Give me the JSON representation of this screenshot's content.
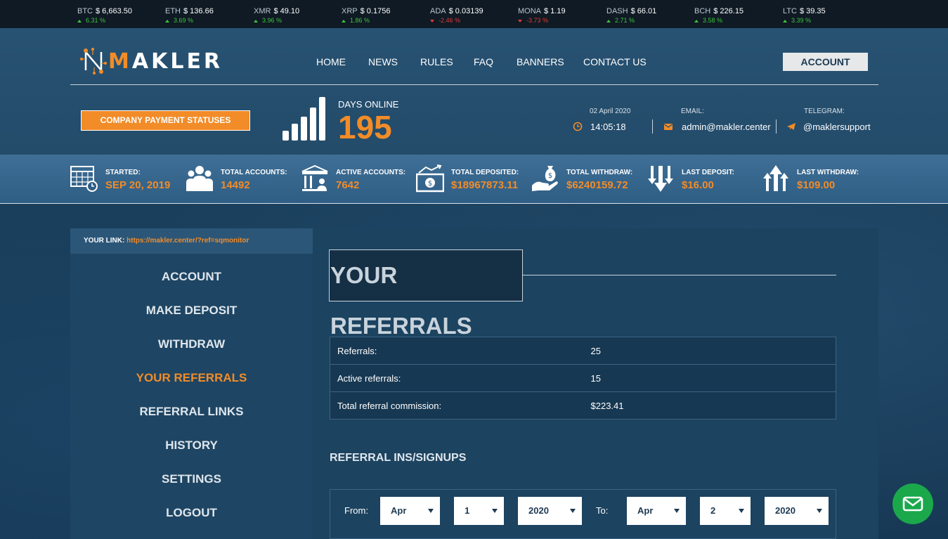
{
  "ticker": [
    {
      "sym": "BTC",
      "price": "$ 6,663.50",
      "change": "6.31 %",
      "dir": "up"
    },
    {
      "sym": "ETH",
      "price": "$ 136.66",
      "change": "3.69 %",
      "dir": "up"
    },
    {
      "sym": "XMR",
      "price": "$ 49.10",
      "change": "3.96 %",
      "dir": "up"
    },
    {
      "sym": "XRP",
      "price": "$ 0.1756",
      "change": "1.86 %",
      "dir": "up"
    },
    {
      "sym": "ADA",
      "price": "$ 0.03139",
      "change": "-2.46 %",
      "dir": "down"
    },
    {
      "sym": "MONA",
      "price": "$ 1.19",
      "change": "-3.73 %",
      "dir": "down"
    },
    {
      "sym": "DASH",
      "price": "$ 66.01",
      "change": "2.71 %",
      "dir": "up"
    },
    {
      "sym": "BCH",
      "price": "$ 226.15",
      "change": "3.58 %",
      "dir": "up"
    },
    {
      "sym": "LTC",
      "price": "$ 39.35",
      "change": "3.39 %",
      "dir": "up"
    }
  ],
  "brand": {
    "initial": "M",
    "rest": "AKLER"
  },
  "nav": [
    "HOME",
    "NEWS",
    "RULES",
    "FAQ",
    "BANNERS",
    "CONTACT US"
  ],
  "account_button": "ACCOUNT",
  "payment_statuses_button": "COMPANY PAYMENT STATUSES",
  "days_online": {
    "label": "DAYS ONLINE",
    "value": "195"
  },
  "datetime": {
    "date": "02 April 2020",
    "time": "14:05:18"
  },
  "email": {
    "label": "EMAIL:",
    "value": "admin@makler.center"
  },
  "telegram": {
    "label": "TELEGRAM:",
    "value": "@maklersupport"
  },
  "stats": [
    {
      "label": "STARTED:",
      "value": "SEP 20, 2019",
      "icon": "calendar-icon"
    },
    {
      "label": "TOTAL ACCOUNTS:",
      "value": "14492",
      "icon": "users-icon"
    },
    {
      "label": "ACTIVE ACCOUNTS:",
      "value": "7642",
      "icon": "bank-user-icon"
    },
    {
      "label": "TOTAL DEPOSITED:",
      "value": "$18967873.11",
      "icon": "cash-icon"
    },
    {
      "label": "TOTAL WITHDRAW:",
      "value": "$6240159.72",
      "icon": "hand-money-icon"
    },
    {
      "label": "LAST DEPOSIT:",
      "value": "$16.00",
      "icon": "arrows-down-icon"
    },
    {
      "label": "LAST WITHDRAW:",
      "value": "$109.00",
      "icon": "arrows-up-icon"
    }
  ],
  "your_link": {
    "label": "YOUR LINK:",
    "url": "https://makler.center/?ref=sqmonitor"
  },
  "sidebar": [
    "ACCOUNT",
    "MAKE DEPOSIT",
    "WITHDRAW",
    "YOUR REFERRALS",
    "REFERRAL LINKS",
    "HISTORY",
    "SETTINGS",
    "LOGOUT"
  ],
  "page_title": "YOUR REFERRALS",
  "referral_table": [
    {
      "label": "Referrals:",
      "value": "25"
    },
    {
      "label": "Active referrals:",
      "value": "15"
    },
    {
      "label": "Total referral commission:",
      "value": "$223.41"
    }
  ],
  "signups_title": "REFERRAL INS/SIGNUPS",
  "filter": {
    "from_label": "From:",
    "to_label": "To:",
    "from_month": "Apr",
    "from_day": "1",
    "from_year": "2020",
    "to_month": "Apr",
    "to_day": "2",
    "to_year": "2020"
  },
  "colors": {
    "accent": "#f28c28",
    "up": "#3ec43e",
    "down": "#e03a3a",
    "fab": "#1aa84b"
  }
}
